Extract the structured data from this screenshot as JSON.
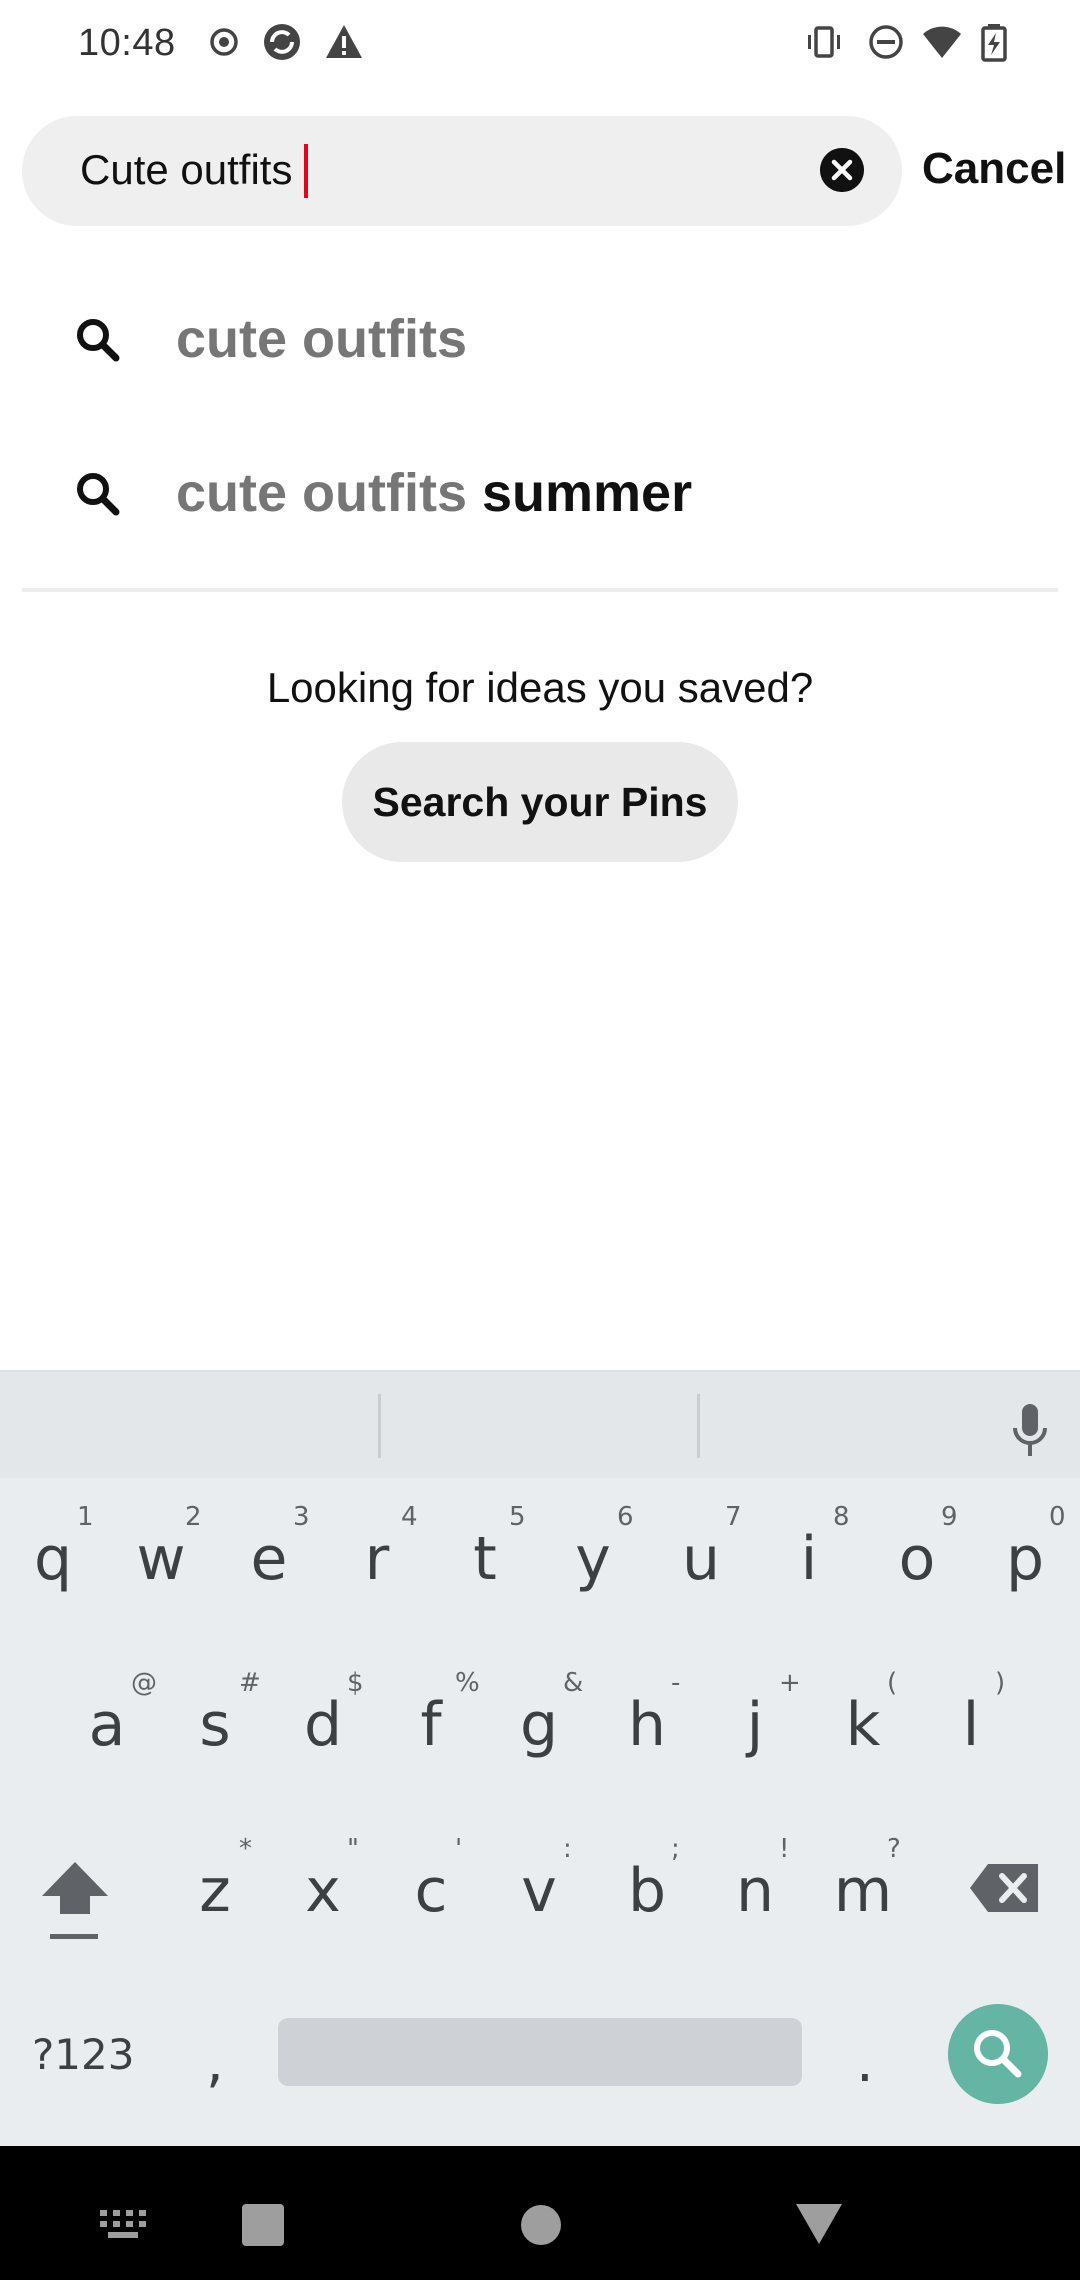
{
  "status_bar": {
    "time": "10:48",
    "left_icons": [
      "record-icon",
      "sync-app-icon",
      "warning-icon"
    ],
    "right_icons": [
      "vibrate-icon",
      "do-not-disturb-icon",
      "wifi-icon",
      "battery-charging-icon"
    ]
  },
  "search": {
    "value": "Cute outfits",
    "clear_icon": "clear-icon",
    "cancel_label": "Cancel",
    "caret_color": "#e60023"
  },
  "suggestions": [
    {
      "icon": "search-icon",
      "match": "cute outfits",
      "rest": ""
    },
    {
      "icon": "search-icon",
      "match": "cute outfits",
      "rest": " summer"
    }
  ],
  "saved_prompt": {
    "text": "Looking for ideas you saved?",
    "button_label": "Search your Pins"
  },
  "keyboard": {
    "row1": [
      {
        "key": "q",
        "hint": "1"
      },
      {
        "key": "w",
        "hint": "2"
      },
      {
        "key": "e",
        "hint": "3"
      },
      {
        "key": "r",
        "hint": "4"
      },
      {
        "key": "t",
        "hint": "5"
      },
      {
        "key": "y",
        "hint": "6"
      },
      {
        "key": "u",
        "hint": "7"
      },
      {
        "key": "i",
        "hint": "8"
      },
      {
        "key": "o",
        "hint": "9"
      },
      {
        "key": "p",
        "hint": "0"
      }
    ],
    "row2": [
      {
        "key": "a",
        "hint": "@"
      },
      {
        "key": "s",
        "hint": "#"
      },
      {
        "key": "d",
        "hint": "$"
      },
      {
        "key": "f",
        "hint": "%"
      },
      {
        "key": "g",
        "hint": "&"
      },
      {
        "key": "h",
        "hint": "-"
      },
      {
        "key": "j",
        "hint": "+"
      },
      {
        "key": "k",
        "hint": "("
      },
      {
        "key": "l",
        "hint": ")"
      }
    ],
    "row3": [
      {
        "key": "z",
        "hint": "*"
      },
      {
        "key": "x",
        "hint": "\""
      },
      {
        "key": "c",
        "hint": "'"
      },
      {
        "key": "v",
        "hint": ":"
      },
      {
        "key": "b",
        "hint": ";"
      },
      {
        "key": "n",
        "hint": "!"
      },
      {
        "key": "m",
        "hint": "?"
      }
    ],
    "symbols_label": "?123",
    "comma_label": ",",
    "period_label": ".",
    "shift_icon": "shift-icon",
    "backspace_icon": "backspace-icon",
    "mic_icon": "microphone-icon",
    "search_key_icon": "search-icon",
    "accent_color": "#64b5a4"
  },
  "navbar": {
    "icons": [
      "keyboard-switch-icon",
      "recents-icon",
      "home-icon",
      "back-icon"
    ]
  }
}
